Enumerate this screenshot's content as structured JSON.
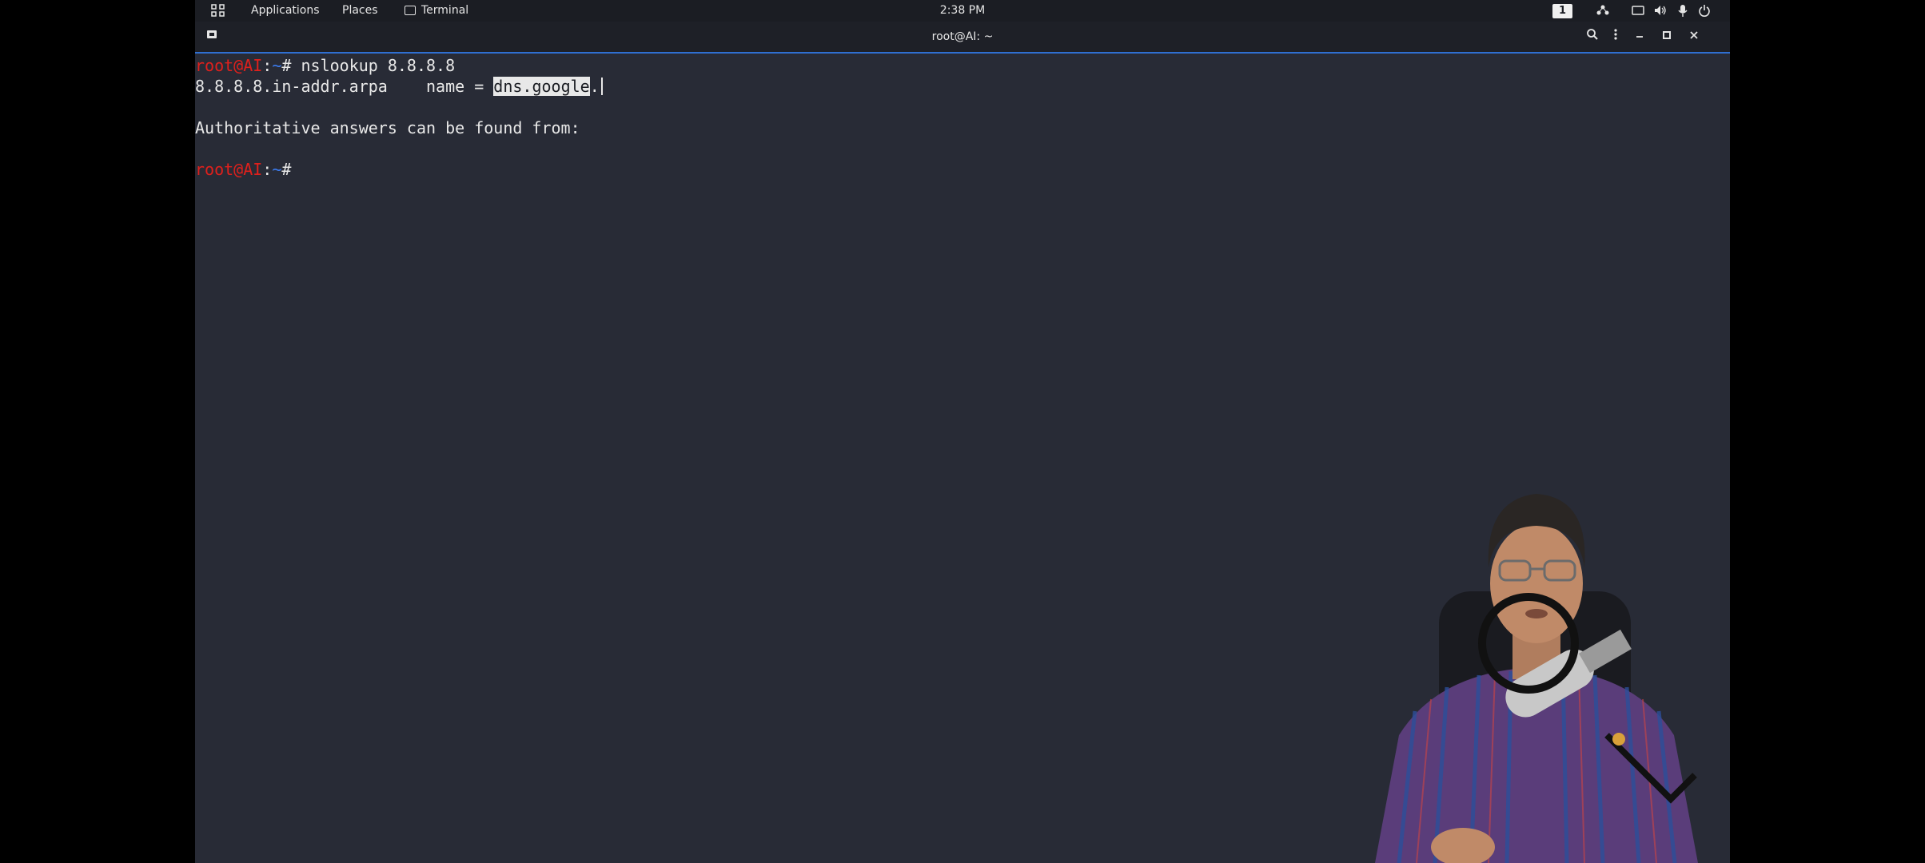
{
  "topbar": {
    "applications": "Applications",
    "places": "Places",
    "terminal": "Terminal",
    "clock": "2:38 PM",
    "workspace": "1",
    "icons": [
      "apps-grid-icon",
      "network-icon",
      "screen-icon",
      "volume-icon",
      "microphone-icon",
      "power-icon"
    ]
  },
  "window": {
    "title": "root@AI: ~",
    "icons": [
      "new-tab-icon",
      "search-icon",
      "menu-icon",
      "minimize-icon",
      "maximize-icon",
      "close-icon"
    ]
  },
  "terminal": {
    "prompt_user": "root@AI",
    "prompt_sep": ":",
    "prompt_path": "~",
    "prompt_end": "# ",
    "line1_cmd": "nslookup 8.8.8.8",
    "line2_prefix": "8.8.8.8.in-addr.arpa    name = ",
    "line2_selected": "dns.google",
    "line2_suffix": ".",
    "line4": "Authoritative answers can be found from:"
  },
  "colors": {
    "terminal_bg": "#282b36",
    "prompt_user": "#e0201c",
    "prompt_path": "#3c7df2",
    "accent": "#2f6fd1"
  }
}
